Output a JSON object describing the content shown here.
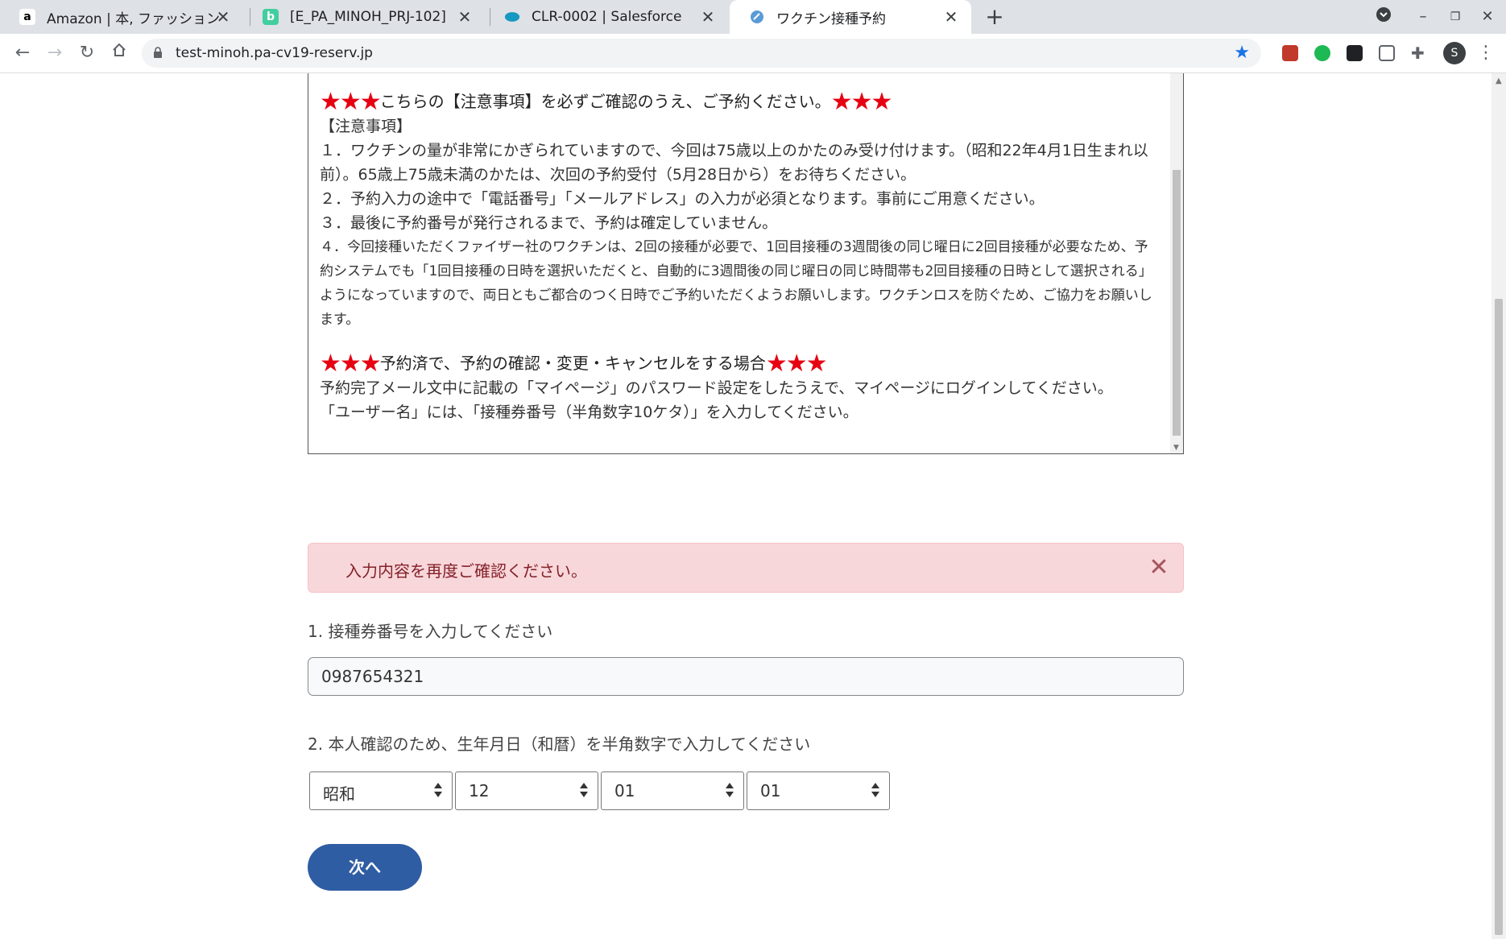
{
  "browser": {
    "tabs": [
      {
        "title": "Amazon | 本, ファッション",
        "favicon": "amazon-icon",
        "active": false
      },
      {
        "title": "[E_PA_MINOH_PRJ-102]",
        "favicon": "backlog-icon",
        "active": false
      },
      {
        "title": "CLR-0002 | Salesforce",
        "favicon": "salesforce-icon",
        "active": false
      },
      {
        "title": "ワクチン接種予約",
        "favicon": "site-icon",
        "active": true
      }
    ],
    "url": "test-minoh.pa-cv19-reserv.jp",
    "profile_initial": "S"
  },
  "notice": {
    "stars": "★★★",
    "heading1": "こちらの【注意事項】を必ずご確認のうえ、ご予約ください。",
    "title": "【注意事項】",
    "items": [
      "１．ワクチンの量が非常にかぎられていますので、今回は75歳以上のかたのみ受け付けます。（昭和22年4月1日生まれ以前）。65歳上75歳未満のかたは、次回の予約受付（5月28日から）をお待ちください。",
      "２．予約入力の途中で「電話番号」「メールアドレス」の入力が必須となります。事前にご用意ください。",
      "３．最後に予約番号が発行されるまで、予約は確定していません。",
      "４．今回接種いただくファイザー社のワクチンは、2回の接種が必要で、1回目接種の3週間後の同じ曜日に2回目接種が必要なため、予約システムでも「1回目接種の日時を選択いただくと、自動的に3週間後の同じ曜日の同じ時間帯も2回目接種の日時として選択される」ようになっていますので、両日ともご都合のつく日時でご予約いただくようお願いします。ワクチンロスを防ぐため、ご協力をお願いします。"
    ],
    "heading2": "予約済で、予約の確認・変更・キャンセルをする場合",
    "line1": "予約完了メール文中に記載の「マイページ」のパスワード設定をしたうえで、マイページにログインしてください。",
    "line2": "「ユーザー名」には、「接種券番号（半角数字10ケタ）」を入力してください。"
  },
  "alert": {
    "message": "入力内容を再度ご確認ください。"
  },
  "form": {
    "q1_label": "1. 接種券番号を入力してください",
    "q1_value": "0987654321",
    "q2_label": "2. 本人確認のため、生年月日（和暦）を半角数字で入力してください",
    "era": "昭和",
    "year": "12",
    "month": "01",
    "day": "01",
    "next_label": "次へ"
  },
  "colors": {
    "accent_star": "#e60012",
    "alert_bg": "#f8d7da",
    "button": "#2f5da3"
  }
}
